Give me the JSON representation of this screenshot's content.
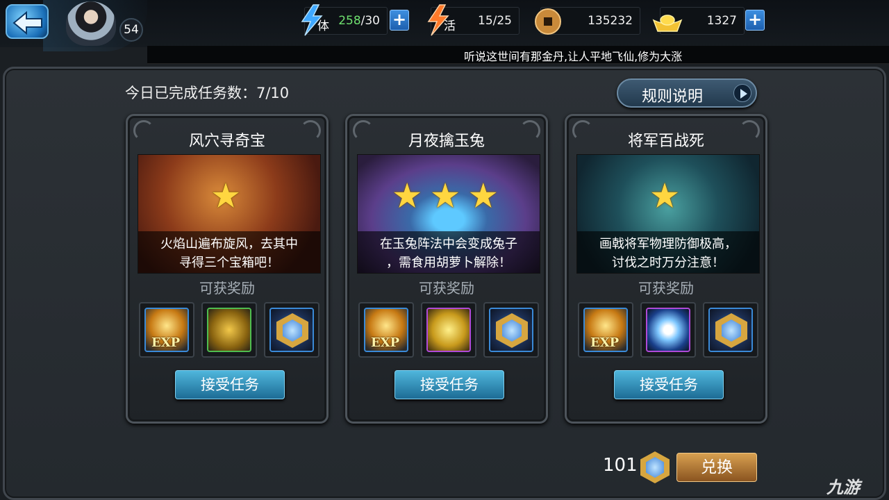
{
  "player": {
    "level": "54"
  },
  "resources": {
    "stamina": {
      "icon": "stamina-lightning-icon",
      "label": "体",
      "current": "258",
      "max": "/30"
    },
    "vitality": {
      "icon": "vitality-lightning-icon",
      "label": "活",
      "value": "15/25"
    },
    "copper": {
      "icon": "copper-coin-icon",
      "value": "135232"
    },
    "ingot": {
      "icon": "gold-ingot-icon",
      "value": "1327"
    },
    "plus": "+"
  },
  "ticker": "听说这世间有那金丹,让人平地飞仙,修为大涨",
  "header": {
    "completed_label": "今日已完成任务数：7/10",
    "rules_button": "规则说明"
  },
  "cards": [
    {
      "title": "风穴寻奇宝",
      "stars": "★",
      "desc_line1": "火焰山遍布旋风，去其中",
      "desc_line2": "寻得三个宝箱吧！",
      "reward_label": "可获奖励",
      "rewards": [
        "exp-scroll-icon",
        "gold-coins-icon",
        "gem-hexagon-icon"
      ],
      "button": "接受任务"
    },
    {
      "title": "月夜擒玉兔",
      "stars": "★★★",
      "desc_line1": "在玉兔阵法中会变成兔子",
      "desc_line2": "，需食用胡萝卜解除！",
      "reward_label": "可获奖励",
      "rewards": [
        "exp-scroll-icon",
        "gold-pile-icon",
        "gem-hexagon-icon"
      ],
      "button": "接受任务"
    },
    {
      "title": "将军百战死",
      "stars": "★",
      "desc_line1": "画戟将军物理防御极高，",
      "desc_line2": "讨伐之时万分注意！",
      "reward_label": "可获奖励",
      "rewards": [
        "exp-scroll-icon",
        "spirit-orb-icon",
        "gem-hexagon-icon"
      ],
      "button": "接受任务"
    }
  ],
  "exp_text": "EXP",
  "footer": {
    "gem_count": "101",
    "exchange_button": "兑换",
    "watermark": "九游"
  }
}
